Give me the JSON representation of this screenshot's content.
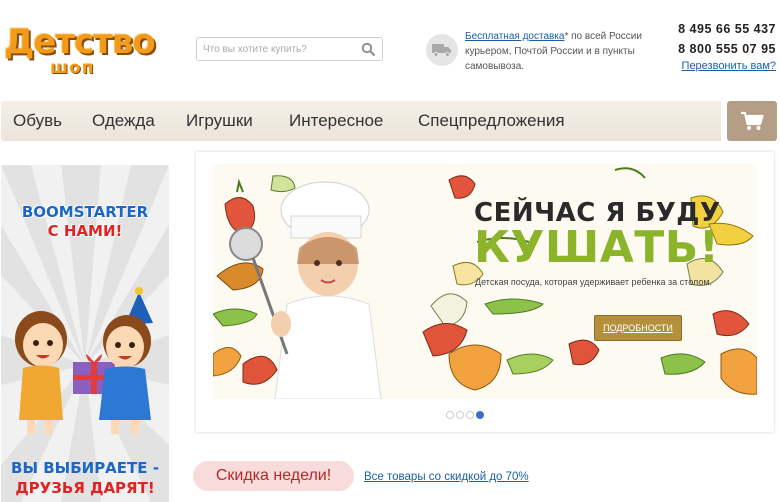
{
  "logo": {
    "main": "Детство",
    "sub": "шоп"
  },
  "search": {
    "placeholder": "Что вы хотите купить?"
  },
  "delivery": {
    "link": "Бесплатная доставка",
    "text": "* по всей России курьером, Почтой России и в пункты самовывоза."
  },
  "phones": [
    "8 495 66 55 437",
    "8 800 555 07 95"
  ],
  "callback": "Перезвонить вам?",
  "nav": [
    "Обувь",
    "Одежда",
    "Игрушки",
    "Интересное",
    "Спецпредложения"
  ],
  "side_banner": {
    "title_line1": "BOOMSTARTER",
    "title_line2": "С НАМИ!",
    "bottom_line1": "ВЫ ВЫБИРАЕТЕ -",
    "bottom_line2": "ДРУЗЬЯ ДАРЯТ!"
  },
  "slide": {
    "heading1": "СЕЙЧАС Я БУДУ",
    "heading2": "КУШАТЬ!",
    "description": "Детская посуда, которая удерживает ребенка за столом.",
    "button": "ПОДРОБНОСТИ"
  },
  "discount": {
    "badge": "Скидка недели!",
    "link": "Все товары со скидкой до 70%"
  },
  "colors": {
    "accent_orange": "#f29a1a",
    "link_blue": "#1a5fa8",
    "nav_bg": "#efe8de",
    "cart_bg": "#b59e86",
    "green": "#8cb42a"
  }
}
